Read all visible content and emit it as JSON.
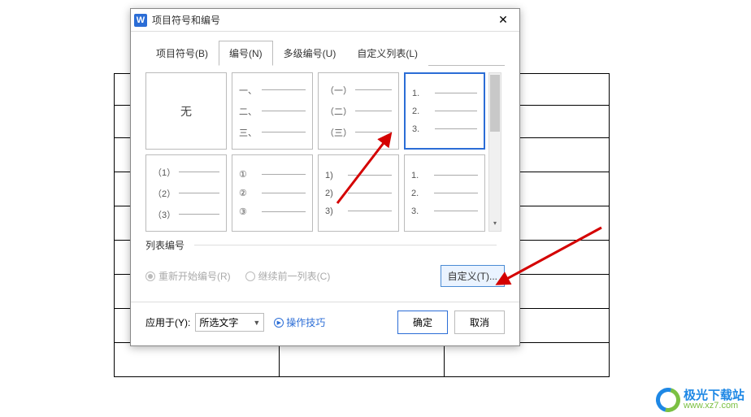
{
  "dialog": {
    "title": "项目符号和编号",
    "app_icon_letter": "W"
  },
  "tabs": {
    "bullets": "项目符号(B)",
    "numbers": "编号(N)",
    "multilevel": "多级编号(U)",
    "customlist": "自定义列表(L)"
  },
  "styles": {
    "none": "无",
    "s1": {
      "l1": "一、",
      "l2": "二、",
      "l3": "三、"
    },
    "s2": {
      "l1": "（一）",
      "l2": "（二）",
      "l3": "（三）"
    },
    "s3": {
      "l1": "1.",
      "l2": "2.",
      "l3": "3."
    },
    "s4": {
      "l1": "（1）",
      "l2": "（2）",
      "l3": "（3）"
    },
    "s5": {
      "l1": "①",
      "l2": "②",
      "l3": "③"
    },
    "s6": {
      "l1": "1)",
      "l2": "2)",
      "l3": "3)"
    },
    "s7": {
      "l1": "1.",
      "l2": "2.",
      "l3": "3."
    }
  },
  "listnum_section": "列表编号",
  "radios": {
    "restart": "重新开始编号(R)",
    "continue": "继续前一列表(C)"
  },
  "buttons": {
    "custom": "自定义(T)...",
    "ok": "确定",
    "cancel": "取消"
  },
  "apply_to": {
    "label": "应用于(Y):",
    "value": "所选文字"
  },
  "help_link": "操作技巧",
  "watermark": {
    "cn": "极光下载站",
    "url": "www.xz7.com"
  }
}
